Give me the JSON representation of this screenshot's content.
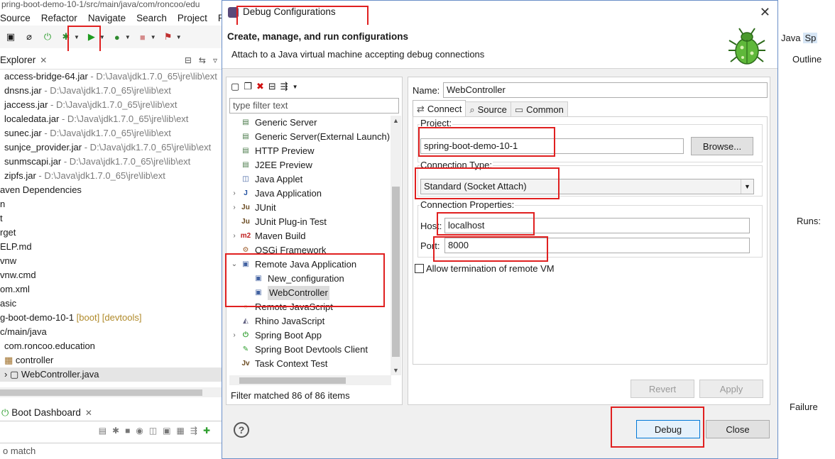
{
  "ide": {
    "title_path": "pring-boot-demo-10-1/src/main/java/com/roncoo/edu",
    "menu": [
      "Source",
      "Refactor",
      "Navigate",
      "Search",
      "Project",
      "Run"
    ],
    "explorer_tab": "Explorer",
    "tree": [
      {
        "name": "access-bridge-64.jar",
        "path": " - D:\\Java\\jdk1.7.0_65\\jre\\lib\\ext"
      },
      {
        "name": "dnsns.jar",
        "path": " - D:\\Java\\jdk1.7.0_65\\jre\\lib\\ext"
      },
      {
        "name": "jaccess.jar",
        "path": " - D:\\Java\\jdk1.7.0_65\\jre\\lib\\ext"
      },
      {
        "name": "localedata.jar",
        "path": " - D:\\Java\\jdk1.7.0_65\\jre\\lib\\ext"
      },
      {
        "name": "sunec.jar",
        "path": " - D:\\Java\\jdk1.7.0_65\\jre\\lib\\ext"
      },
      {
        "name": "sunjce_provider.jar",
        "path": " - D:\\Java\\jdk1.7.0_65\\jre\\lib\\ext"
      },
      {
        "name": "sunmscapi.jar",
        "path": " - D:\\Java\\jdk1.7.0_65\\jre\\lib\\ext"
      },
      {
        "name": "zipfs.jar",
        "path": " - D:\\Java\\jdk1.7.0_65\\jre\\lib\\ext"
      },
      {
        "name": "aven Dependencies",
        "path": ""
      },
      {
        "name": "n",
        "path": ""
      },
      {
        "name": "t",
        "path": ""
      },
      {
        "name": "rget",
        "path": ""
      },
      {
        "name": "ELP.md",
        "path": ""
      },
      {
        "name": "vnw",
        "path": ""
      },
      {
        "name": "vnw.cmd",
        "path": ""
      },
      {
        "name": "om.xml",
        "path": ""
      },
      {
        "name": "asic",
        "path": ""
      },
      {
        "name": "g-boot-demo-10-1",
        "path": "",
        "deco": " [boot] [devtools]"
      },
      {
        "name": "c/main/java",
        "path": ""
      },
      {
        "name": "com.roncoo.education",
        "path": ""
      },
      {
        "name": "controller",
        "path": ""
      },
      {
        "name": "WebController.java",
        "path": ""
      }
    ],
    "boot_tab": "Boot Dashboard",
    "boot_search": "o match",
    "perspective_java": "Java",
    "perspective_spring": "Sp",
    "outline_tab": "Outline",
    "runs_label": "Runs:",
    "failure_label": "Failure"
  },
  "dialog": {
    "title": "Debug Configurations",
    "header_title": "Create, manage, and run configurations",
    "header_desc": "Attach to a Java virtual machine accepting debug connections",
    "filter_placeholder": "type filter text",
    "tree": [
      {
        "label": "Generic Server",
        "icon": "server-icon",
        "expand": ""
      },
      {
        "label": "Generic Server(External Launch)",
        "icon": "server-icon",
        "expand": ""
      },
      {
        "label": "HTTP Preview",
        "icon": "server-icon",
        "expand": ""
      },
      {
        "label": "J2EE Preview",
        "icon": "server-icon",
        "expand": ""
      },
      {
        "label": "Java Applet",
        "icon": "applet-icon",
        "expand": ""
      },
      {
        "label": "Java Application",
        "icon": "java-app-icon",
        "expand": "›"
      },
      {
        "label": "JUnit",
        "icon": "junit-icon",
        "expand": "›"
      },
      {
        "label": "JUnit Plug-in Test",
        "icon": "junit-plugin-icon",
        "expand": ""
      },
      {
        "label": "Maven Build",
        "icon": "maven-icon",
        "expand": "›"
      },
      {
        "label": "OSGi Framework",
        "icon": "osgi-icon",
        "expand": ""
      },
      {
        "label": "Remote Java Application",
        "icon": "remote-java-icon",
        "expand": "⌄"
      },
      {
        "label": "New_configuration",
        "icon": "remote-config-icon",
        "expand": "",
        "indent": 1
      },
      {
        "label": "WebController",
        "icon": "remote-config-icon",
        "expand": "",
        "indent": 1,
        "selected": true
      },
      {
        "label": "Remote JavaScript",
        "icon": "remote-js-icon",
        "expand": ""
      },
      {
        "label": "Rhino JavaScript",
        "icon": "rhino-icon",
        "expand": ""
      },
      {
        "label": "Spring Boot App",
        "icon": "spring-boot-icon",
        "expand": "›"
      },
      {
        "label": "Spring Boot Devtools Client",
        "icon": "spring-devtools-icon",
        "expand": ""
      },
      {
        "label": "Task Context Test",
        "icon": "task-context-icon",
        "expand": ""
      }
    ],
    "filter_status": "Filter matched 86 of 86 items",
    "name_label": "Name:",
    "name_value": "WebController",
    "tabs": [
      "Connect",
      "Source",
      "Common"
    ],
    "project_label": "Project:",
    "project_value": "spring-boot-demo-10-1",
    "browse_label": "Browse...",
    "connection_type_label": "Connection Type:",
    "connection_type_value": "Standard (Socket Attach)",
    "connection_props_label": "Connection Properties:",
    "host_label": "Host:",
    "host_value": "localhost",
    "port_label": "Port:",
    "port_value": "8000",
    "allow_termination_label": "Allow termination of remote VM",
    "allow_termination_checked": false,
    "revert_label": "Revert",
    "apply_label": "Apply",
    "debug_label": "Debug",
    "close_label": "Close"
  },
  "colors": {
    "highlight": "#e02020",
    "accent": "#0078d7"
  }
}
